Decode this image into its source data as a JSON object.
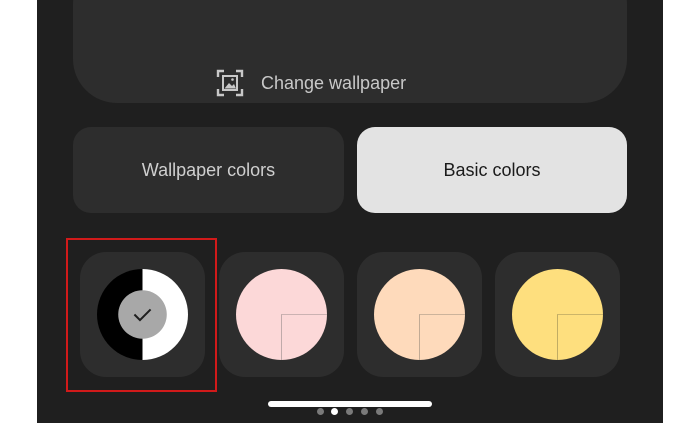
{
  "wallpaper": {
    "change_label": "Change wallpaper",
    "icon": "image-icon"
  },
  "tabs": [
    {
      "label": "Wallpaper colors",
      "selected": false
    },
    {
      "label": "Basic colors",
      "selected": true
    }
  ],
  "swatches": [
    {
      "name": "monochrome",
      "colors": [
        "#000000",
        "#ffffff",
        "#a8a8a8"
      ],
      "selected": true,
      "icon": "checkmark-icon"
    },
    {
      "name": "pink",
      "colors": [
        "#fcd8d8"
      ],
      "selected": false
    },
    {
      "name": "peach",
      "colors": [
        "#fedabb"
      ],
      "selected": false
    },
    {
      "name": "yellow",
      "colors": [
        "#fedf7e"
      ],
      "selected": false
    }
  ],
  "pager": {
    "page_count": 5,
    "current_page": 2
  },
  "colors": {
    "background": "#1f1f1f",
    "card": "#2d2d2d",
    "selected_tab": "#e3e3e3",
    "highlight": "#d11a1a"
  }
}
